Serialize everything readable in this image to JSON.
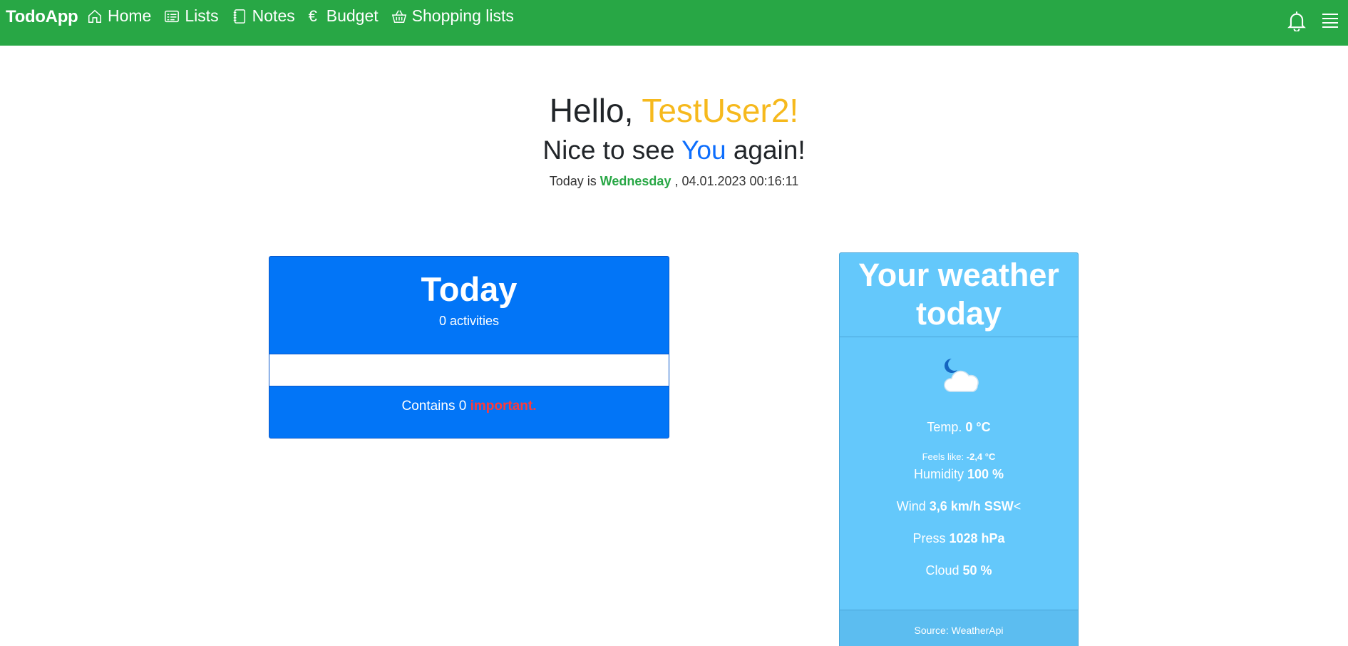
{
  "nav": {
    "brand": "TodoApp",
    "items": [
      {
        "label": "Home",
        "icon": "house-icon"
      },
      {
        "label": "Lists",
        "icon": "list-card-icon"
      },
      {
        "label": "Notes",
        "icon": "notebook-icon"
      },
      {
        "label": "Budget",
        "icon": "euro-icon",
        "glyph": "€"
      },
      {
        "label": "Shopping lists",
        "icon": "basket-icon"
      }
    ],
    "bell_icon": "bell-icon",
    "menu_icon": "hamburger-menu-icon",
    "background_color": "#28a745"
  },
  "greeting": {
    "hello": "Hello,",
    "username": "TestUser2!",
    "nice_prefix": "Nice to see",
    "nice_you": "You",
    "nice_suffix": "again!",
    "today_prefix": "Today is",
    "weekday": "Wednesday",
    "datetime": ", 04.01.2023 00:16:11"
  },
  "today_card": {
    "title": "Today",
    "activities": "0 activities",
    "important_prefix": "Contains 0",
    "important_word": "important.",
    "color": "#0275f7"
  },
  "weather": {
    "title": "Your weather today",
    "icon": "moon-cloud-icon",
    "temp_label": "Temp.",
    "temp_value": "0 °C",
    "feels_label": "Feels like:",
    "feels_value": "-2,4 °C",
    "humidity_label": "Humidity",
    "humidity_value": "100 %",
    "wind_label": "Wind",
    "wind_value": "3,6 km/h SSW",
    "wind_arrow": "<",
    "pressure_label": "Press",
    "pressure_value": "1028 hPa",
    "cloud_label": "Cloud",
    "cloud_value": "50 %",
    "source": "Source: WeatherApi",
    "color": "#64c8fb"
  }
}
